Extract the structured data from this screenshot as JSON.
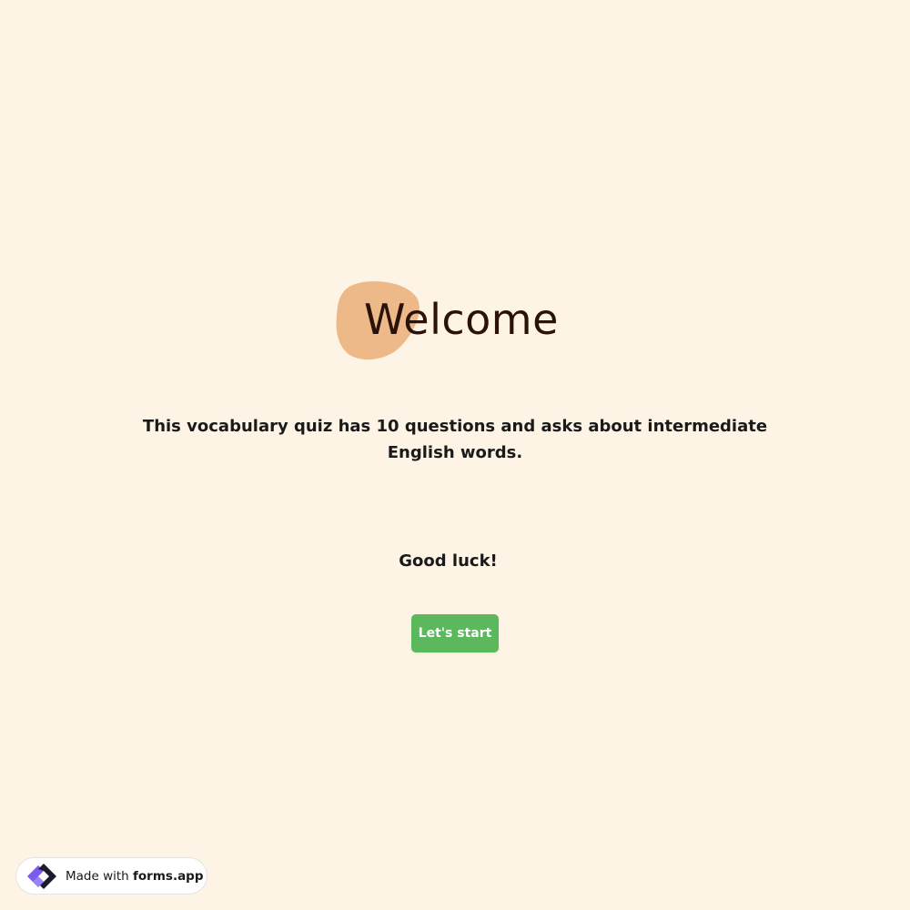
{
  "welcome": {
    "title": "Welcome",
    "description": "This vocabulary quiz has 10 questions and asks about intermediate English words.",
    "closing": "Good luck!",
    "start_button": "Let's start"
  },
  "footer": {
    "badge_prefix": "Made with",
    "badge_brand": "forms.app",
    "logo_icon": "forms-app-logo-icon"
  },
  "colors": {
    "background": "#fdf4e5",
    "blob": "#edb988",
    "title_text": "#2a1209",
    "start_button": "#5cb85c",
    "logo_purple": "#7b5bef",
    "logo_dark": "#1b1b2e"
  }
}
